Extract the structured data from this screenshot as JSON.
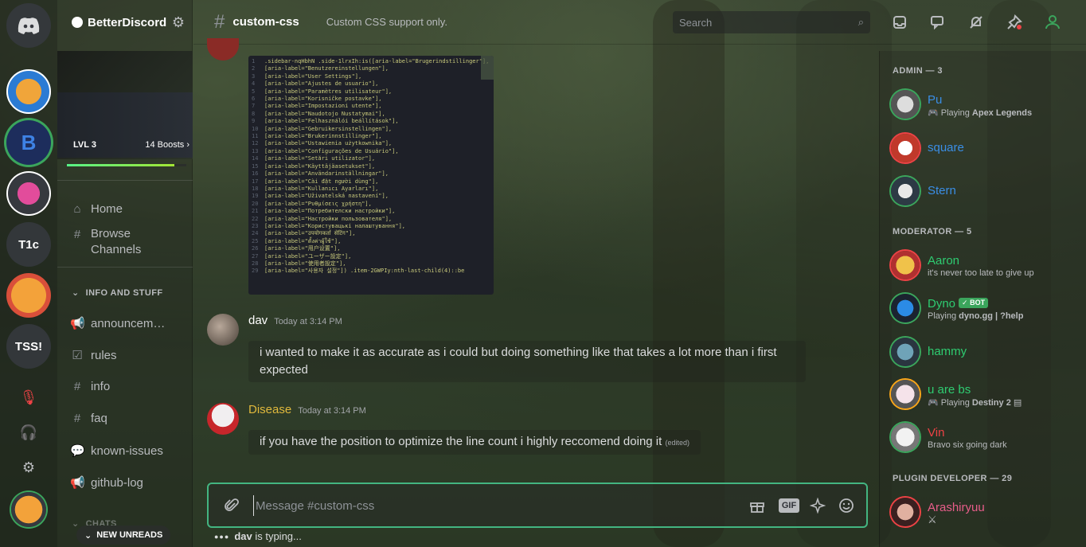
{
  "colors": {
    "accent": "#43b581",
    "link_blue": "#3a8ee6",
    "mod_green": "#2ecc71",
    "author_yellow": "#e0b93c",
    "admin_red": "#ed4245"
  },
  "server_list": {
    "home_icon": "discord-logo-icon",
    "items": [
      {
        "label": "T1c"
      },
      {
        "label": "TSS!"
      }
    ]
  },
  "guild": {
    "name": "BetterDiscord",
    "level": "LVL 3",
    "boosts": "14 Boosts",
    "boost_progress": 0.9,
    "nav": [
      {
        "label": "Home",
        "icon": "home-icon"
      },
      {
        "label": "Browse Channels",
        "icon": "browse-channels-icon"
      }
    ],
    "category": "INFO AND STUFF",
    "channels": [
      {
        "label": "announcem…",
        "icon": "megaphone-icon"
      },
      {
        "label": "rules",
        "icon": "checkbox-icon"
      },
      {
        "label": "info",
        "icon": "hash-icon"
      },
      {
        "label": "faq",
        "icon": "hash-icon"
      },
      {
        "label": "known-issues",
        "icon": "forum-icon"
      },
      {
        "label": "github-log",
        "icon": "megaphone-icon"
      }
    ],
    "next_category": "CHATS",
    "new_unreads": "NEW UNREADS"
  },
  "header": {
    "channel": "custom-css",
    "topic": "Custom CSS support only.",
    "search_placeholder": "Search"
  },
  "code_block": {
    "lines": [
      ".sidebar-nqHbhN .side-1lrxIh:is([aria-label=\"Brugerindstillinger\"],",
      "[aria-label=\"Benutzereinstellungen\"],",
      "[aria-label=\"User Settings\"],",
      "[aria-label=\"Ajustes de usuario\"],",
      "[aria-label=\"Paramètres utilisateur\"],",
      "[aria-label=\"Korisničke postavke\"],",
      "[aria-label=\"Impostazioni utente\"],",
      "[aria-label=\"Naudotojo Nustatymai\"],",
      "[aria-label=\"Felhasználói beállítások\"],",
      "[aria-label=\"Gebruikersinstellingen\"],",
      "[aria-label=\"Brukerinnstillinger\"],",
      "[aria-label=\"Ustawienia użytkownika\"],",
      "[aria-label=\"Configurações de Usuário\"],",
      "[aria-label=\"Setări utilizator\"],",
      "[aria-label=\"Käyttäjäasetukset\"],",
      "[aria-label=\"Användarinställningar\"],",
      "[aria-label=\"Cài đặt người dùng\"],",
      "[aria-label=\"Kullanıcı Ayarları\"],",
      "[aria-label=\"Uživatelská nastavení\"],",
      "[aria-label=\"Ρυθμίσεις χρήστη\"],",
      "[aria-label=\"Потребителски настройки\"],",
      "[aria-label=\"Настройки пользователя\"],",
      "[aria-label=\"Користувацькі налаштування\"],",
      "[aria-label=\"उपयोगकर्ता सेटिंग\"],",
      "[aria-label=\"ตั้งค่าผู้ใช้\"],",
      "[aria-label=\"用户设置\"],",
      "[aria-label=\"ユーザー設定\"],",
      "[aria-label=\"使用者設定\"],",
      "[aria-label=\"사용자 설정\"]) .item-2GWPIy:nth-last-child(4)::be"
    ]
  },
  "messages": [
    {
      "author": "dav",
      "timestamp": "Today at 3:14 PM",
      "text": "i wanted to make it as accurate as i could but doing something like that takes a lot more than i first expected"
    },
    {
      "author": "Disease",
      "timestamp": "Today at 3:14 PM",
      "text": "if you have the position to optimize the line count i highly reccomend doing it",
      "edited": "(edited)"
    }
  ],
  "composer": {
    "placeholder": "Message #custom-css",
    "gif": "GIF"
  },
  "typing": {
    "user": "dav",
    "text": "is typing..."
  },
  "members": {
    "roles": [
      {
        "label": "ADMIN — 3"
      },
      {
        "label": "MODERATOR — 5"
      },
      {
        "label": "PLUGIN DEVELOPER — 29"
      }
    ],
    "list": [
      {
        "name": "Pu",
        "activity_prefix": "Playing ",
        "activity": "Apex Legends"
      },
      {
        "name": "square",
        "activity_prefix": "",
        "activity": ""
      },
      {
        "name": "Stern",
        "activity_prefix": "",
        "activity": ""
      },
      {
        "name": "Aaron",
        "activity_prefix": "",
        "activity": "it's never too late to give up"
      },
      {
        "name": "Dyno",
        "bot": "BOT",
        "activity_prefix": "Playing ",
        "activity": "dyno.gg | ?help"
      },
      {
        "name": "hammy",
        "activity_prefix": "",
        "activity": ""
      },
      {
        "name": "u are bs",
        "activity_prefix": "Playing ",
        "activity": "Destiny 2"
      },
      {
        "name": "Vin",
        "activity_prefix": "",
        "activity": "Bravo six going dark"
      },
      {
        "name": "Arashiryuu",
        "activity_prefix": "",
        "activity": ""
      }
    ]
  }
}
